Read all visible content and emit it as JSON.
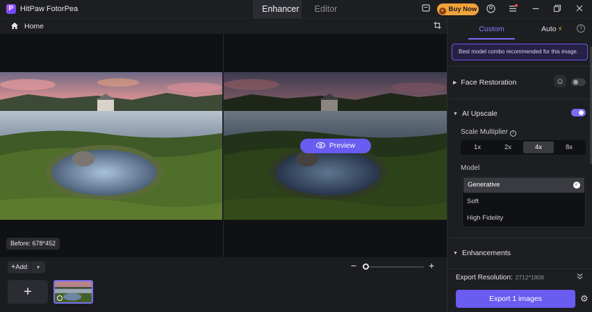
{
  "app": {
    "title": "HitPaw FotorPea",
    "logo_letter": "P"
  },
  "titlebar": {
    "tabs": [
      {
        "label": "Enhancer"
      },
      {
        "label": "Editor"
      }
    ],
    "buy_label": "Buy Now",
    "icons": [
      "feedback-icon",
      "cart-icon",
      "account-icon",
      "menu-icon",
      "minimize-icon",
      "restore-icon",
      "close-icon"
    ]
  },
  "homebar": {
    "home_label": "Home"
  },
  "canvas": {
    "preview_label": "Preview",
    "before_label": "Before: 678*452"
  },
  "bottom": {
    "add_label": "Add"
  },
  "panel": {
    "tab_custom": "Custom",
    "tab_auto": "Auto",
    "recommendation": "Best model combo recommended for this image.",
    "face_restoration": {
      "label": "Face Restoration",
      "enabled": false
    },
    "ai_upscale": {
      "label": "AI Upscale",
      "enabled": true,
      "scale_label": "Scale Multiplier",
      "scale_options": [
        "1x",
        "2x",
        "4x",
        "8x"
      ],
      "scale_selected": "4x",
      "model_label": "Model",
      "models": [
        "Generative",
        "Soft",
        "High Fidelity"
      ],
      "model_selected": "Generative"
    },
    "enhancements_label": "Enhancements",
    "export_resolution_label": "Export Resolution:",
    "export_resolution_value": "2712*1808",
    "export_button": "Export 1 images"
  },
  "colors": {
    "accent": "#6a5cf0",
    "buy": "#f0a23b",
    "background": "#1d1e22"
  }
}
